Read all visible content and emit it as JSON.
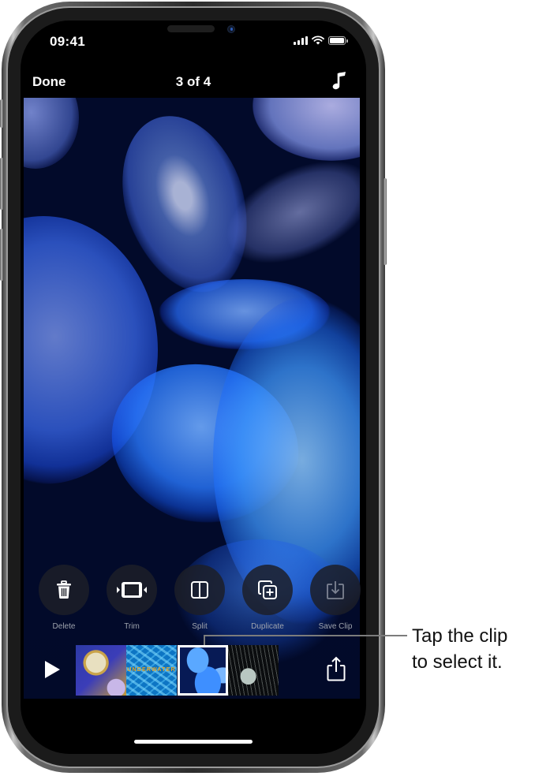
{
  "status_bar": {
    "time": "09:41",
    "icons": [
      "cellular-signal-icon",
      "wifi-icon",
      "battery-icon"
    ]
  },
  "nav": {
    "done_label": "Done",
    "title": "3 of 4",
    "music_icon": "music-note-icon"
  },
  "actions": [
    {
      "label": "Delete",
      "icon": "trash-icon",
      "enabled": true
    },
    {
      "label": "Trim",
      "icon": "trim-icon",
      "enabled": true
    },
    {
      "label": "Split",
      "icon": "split-icon",
      "enabled": true
    },
    {
      "label": "Duplicate",
      "icon": "duplicate-icon",
      "enabled": true
    },
    {
      "label": "Save Clip",
      "icon": "save-clip-icon",
      "enabled": false
    }
  ],
  "timeline": {
    "play_icon": "play-icon",
    "share_icon": "share-icon",
    "clips": [
      {
        "description": "yellow-jellyfish",
        "selected": false
      },
      {
        "description": "underwater-title",
        "text": "UNDERWATER",
        "selected": false
      },
      {
        "description": "blue-jellyfish",
        "selected": true
      },
      {
        "description": "white-jellyfish",
        "selected": false
      }
    ]
  },
  "callout": {
    "line1": "Tap the clip",
    "line2": "to select it."
  }
}
